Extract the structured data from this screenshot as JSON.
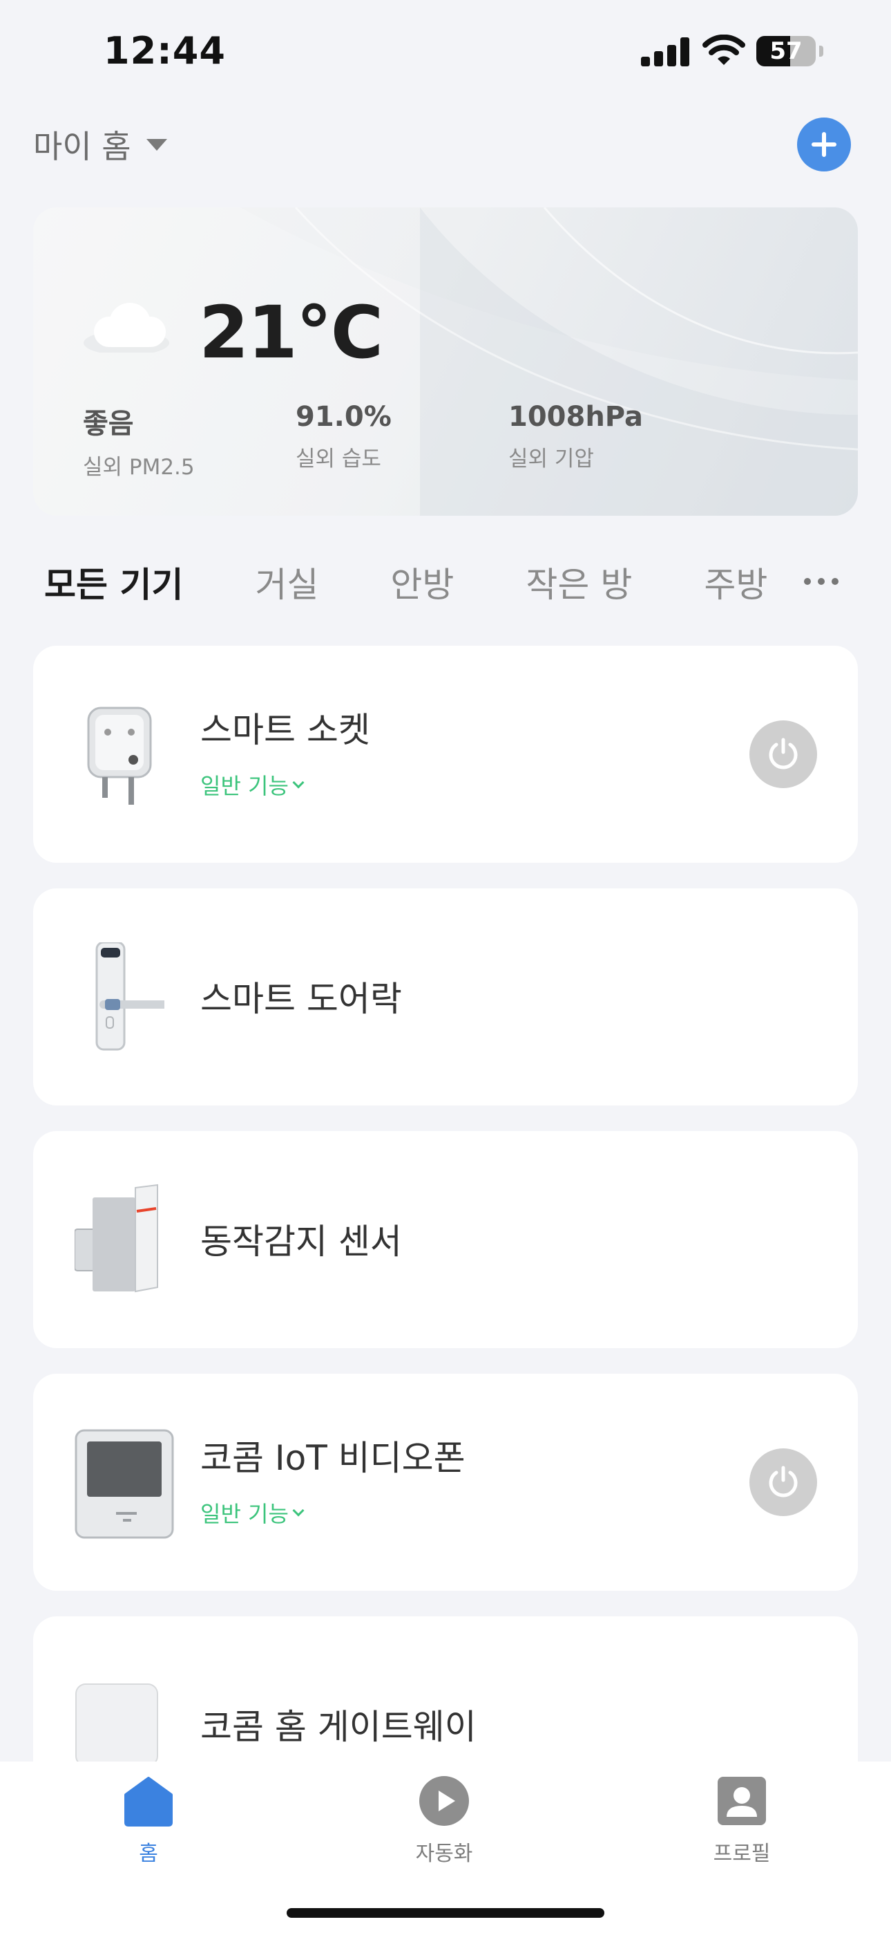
{
  "status_bar": {
    "time": "12:44",
    "battery": "57"
  },
  "header": {
    "home_name": "마이 홈",
    "icons": [
      "chevron-down-icon",
      "add-icon"
    ]
  },
  "weather": {
    "icon": "cloud-icon",
    "temperature": "21°C",
    "items": [
      {
        "value": "좋음",
        "label": "실외 PM2.5"
      },
      {
        "value": "91.0%",
        "label": "실외 습도"
      },
      {
        "value": "1008hPa",
        "label": "실외 기압"
      }
    ]
  },
  "tabs": [
    "모든 기기",
    "거실",
    "안방",
    "작은 방",
    "주방"
  ],
  "devices": [
    {
      "name": "스마트 소켓",
      "sub": "일반 기능",
      "icon": "smart-plug-icon",
      "has_power": true
    },
    {
      "name": "스마트 도어락",
      "icon": "door-lock-icon",
      "has_power": false
    },
    {
      "name": "동작감지 센서",
      "icon": "motion-sensor-icon",
      "has_power": false
    },
    {
      "name": "코콤 IoT 비디오폰",
      "sub": "일반 기능",
      "icon": "video-phone-icon",
      "has_power": true
    },
    {
      "name": "코콤 홈 게이트웨이",
      "icon": "gateway-icon",
      "has_power": false
    }
  ],
  "tabbar": {
    "items": [
      {
        "label": "홈",
        "icon": "home-icon"
      },
      {
        "label": "자동화",
        "icon": "play-icon"
      },
      {
        "label": "프로필",
        "icon": "profile-icon"
      }
    ],
    "active_color": "#3b82e0"
  }
}
